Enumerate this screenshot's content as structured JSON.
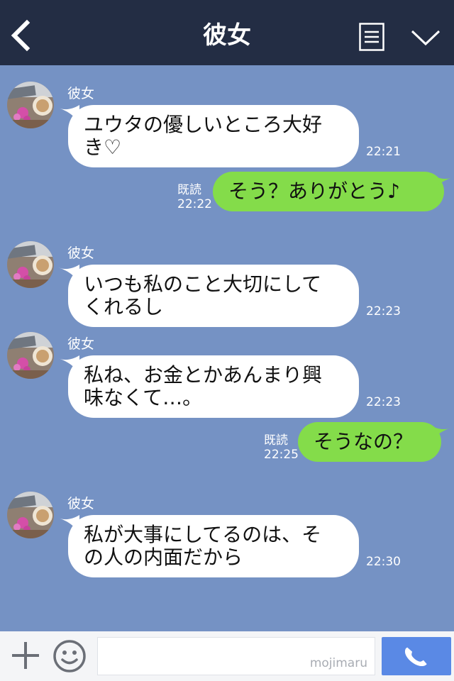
{
  "header": {
    "title": "彼女",
    "back_icon": "chevron-left-icon",
    "menu_icon": "menu-list-icon",
    "collapse_icon": "chevron-down-icon"
  },
  "messages": [
    {
      "direction": "in",
      "sender": "彼女",
      "lines": [
        "ユウタの優しいところ大好",
        "き♡"
      ],
      "time": "22:21"
    },
    {
      "direction": "out",
      "text": "そう？ありがとう♪",
      "read": "既読",
      "time": "22:22"
    },
    {
      "direction": "in",
      "sender": "彼女",
      "lines": [
        "いつも私のこと大切にして",
        "くれるし"
      ],
      "time": "22:23"
    },
    {
      "direction": "in",
      "sender": "彼女",
      "lines": [
        "私ね、お金とかあんまり興",
        "味なくて…。"
      ],
      "time": "22:23"
    },
    {
      "direction": "out",
      "text": "そうなの？",
      "read": "既読",
      "time": "22:25"
    },
    {
      "direction": "in",
      "sender": "彼女",
      "lines": [
        "私が大事にしてるのは、そ",
        "の人の内面だから"
      ],
      "time": "22:30"
    }
  ],
  "footer": {
    "plus_icon": "plus-icon",
    "emoji_icon": "emoji-icon",
    "input_value": "",
    "watermark": "mojimaru",
    "call_icon": "phone-icon"
  },
  "colors": {
    "header_bg": "#232d44",
    "chat_bg": "#7592c4",
    "bubble_in": "#ffffff",
    "bubble_out": "#84dc4a",
    "call_button": "#5a89e5"
  }
}
